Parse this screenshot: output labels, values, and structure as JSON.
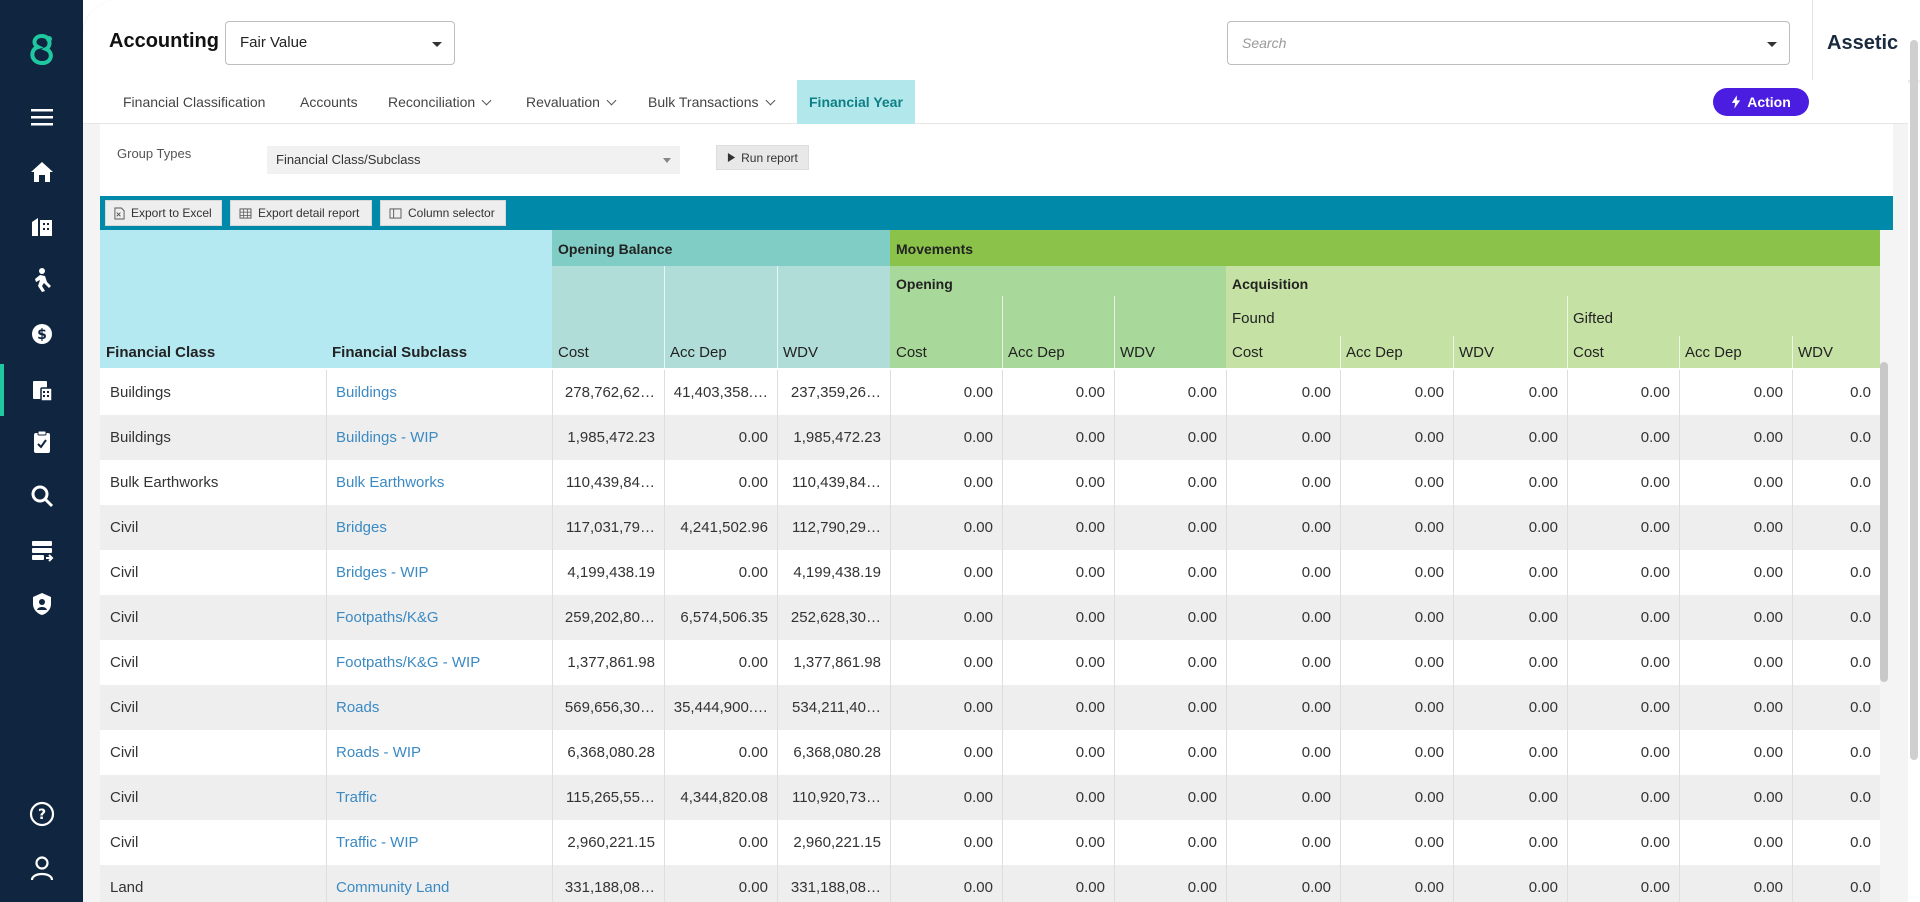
{
  "header": {
    "app_title": "Accounting",
    "mode_select": "Fair Value",
    "search_placeholder": "Search",
    "brand": "Assetic"
  },
  "nav": {
    "items": [
      {
        "label": "Financial Classification",
        "has_menu": false
      },
      {
        "label": "Accounts",
        "has_menu": false
      },
      {
        "label": "Reconciliation",
        "has_menu": true
      },
      {
        "label": "Revaluation",
        "has_menu": true
      },
      {
        "label": "Bulk Transactions",
        "has_menu": true
      },
      {
        "label": "Financial Year",
        "has_menu": false,
        "active": true
      }
    ],
    "action_label": "Action"
  },
  "sidebar": {
    "icons": [
      "logo-icon",
      "menu-icon",
      "home-icon",
      "buildings-icon",
      "worker-icon",
      "finance-icon",
      "accounting-icon",
      "task-icon",
      "search-icon",
      "data-transfer-icon",
      "security-icon",
      "help-icon",
      "user-icon"
    ]
  },
  "filters": {
    "group_types_label": "Group Types",
    "group_types_value": "Financial Class/Subclass",
    "run_report_label": "Run report"
  },
  "toolbar": {
    "export_excel": "Export to Excel",
    "export_detail": "Export detail report",
    "column_selector": "Column selector"
  },
  "table": {
    "headers": {
      "financial_class": "Financial Class",
      "financial_subclass": "Financial Subclass",
      "opening_balance": "Opening Balance",
      "movements": "Movements",
      "opening": "Opening",
      "acquisition": "Acquisition",
      "found": "Found",
      "gifted": "Gifted",
      "cost": "Cost",
      "acc_dep": "Acc Dep",
      "wdv": "WDV"
    },
    "rows": [
      {
        "class": "Buildings",
        "subclass": "Buildings",
        "cost": "278,762,62…",
        "acc_dep": "41,403,358.…",
        "wdv": "237,359,26…"
      },
      {
        "class": "Buildings",
        "subclass": "Buildings - WIP",
        "cost": "1,985,472.23",
        "acc_dep": "0.00",
        "wdv": "1,985,472.23"
      },
      {
        "class": "Bulk Earthworks",
        "subclass": "Bulk Earthworks",
        "cost": "110,439,84…",
        "acc_dep": "0.00",
        "wdv": "110,439,84…"
      },
      {
        "class": "Civil",
        "subclass": "Bridges",
        "cost": "117,031,79…",
        "acc_dep": "4,241,502.96",
        "wdv": "112,790,29…"
      },
      {
        "class": "Civil",
        "subclass": "Bridges - WIP",
        "cost": "4,199,438.19",
        "acc_dep": "0.00",
        "wdv": "4,199,438.19"
      },
      {
        "class": "Civil",
        "subclass": "Footpaths/K&G",
        "cost": "259,202,80…",
        "acc_dep": "6,574,506.35",
        "wdv": "252,628,30…"
      },
      {
        "class": "Civil",
        "subclass": "Footpaths/K&G - WIP",
        "cost": "1,377,861.98",
        "acc_dep": "0.00",
        "wdv": "1,377,861.98"
      },
      {
        "class": "Civil",
        "subclass": "Roads",
        "cost": "569,656,30…",
        "acc_dep": "35,444,900.…",
        "wdv": "534,211,40…"
      },
      {
        "class": "Civil",
        "subclass": "Roads - WIP",
        "cost": "6,368,080.28",
        "acc_dep": "0.00",
        "wdv": "6,368,080.28"
      },
      {
        "class": "Civil",
        "subclass": "Traffic",
        "cost": "115,265,55…",
        "acc_dep": "4,344,820.08",
        "wdv": "110,920,73…"
      },
      {
        "class": "Civil",
        "subclass": "Traffic - WIP",
        "cost": "2,960,221.15",
        "acc_dep": "0.00",
        "wdv": "2,960,221.15"
      },
      {
        "class": "Land",
        "subclass": "Community Land",
        "cost": "331,188,08…",
        "acc_dep": "0.00",
        "wdv": "331,188,08…"
      }
    ],
    "movement_value": "0.00",
    "truncated_value": "0.0"
  }
}
